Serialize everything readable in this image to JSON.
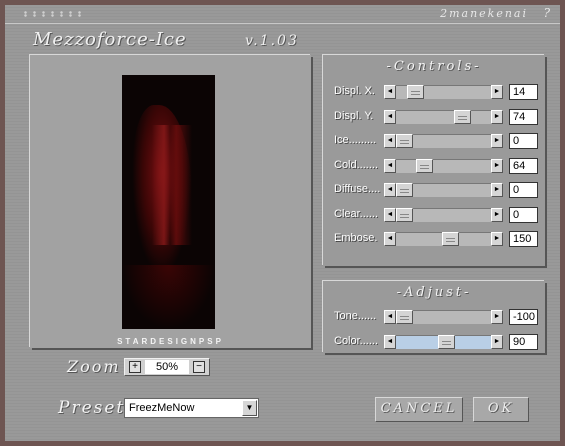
{
  "window": {
    "author": "2manekenai",
    "help": "?",
    "title": "Mezzoforce-Ice",
    "version": "v.1.03"
  },
  "preview": {
    "caption": "STARDESIGNPSP"
  },
  "controls": {
    "title": "-Controls-",
    "sliders": [
      {
        "label": "Displ. X.",
        "value": "14",
        "level": 14
      },
      {
        "label": "Displ. Y.",
        "value": "74",
        "level": 74
      },
      {
        "label": "Ice.........",
        "value": "0",
        "level": 0
      },
      {
        "label": "Cold.......",
        "value": "64",
        "level": 64
      },
      {
        "label": "Diffuse....",
        "value": "0",
        "level": 0
      },
      {
        "label": "Clear......",
        "value": "0",
        "level": 0
      },
      {
        "label": "Embose.",
        "value": "150",
        "level": 150
      }
    ]
  },
  "adjust": {
    "title": "-Adjust-",
    "sliders": [
      {
        "label": "Tone......",
        "value": "-100",
        "level": -100
      },
      {
        "label": "Color......",
        "value": "90",
        "level": 90
      }
    ]
  },
  "zoom": {
    "label": "Zoom",
    "value": "50%",
    "plus": "+",
    "minus": "−"
  },
  "preset": {
    "label": "Preset",
    "value": "FreezMeNow"
  },
  "buttons": {
    "cancel": "CANCEL",
    "ok": "OK"
  },
  "icons": {
    "left_arrow": "◄",
    "right_arrow": "►",
    "dropdown": "▼"
  }
}
